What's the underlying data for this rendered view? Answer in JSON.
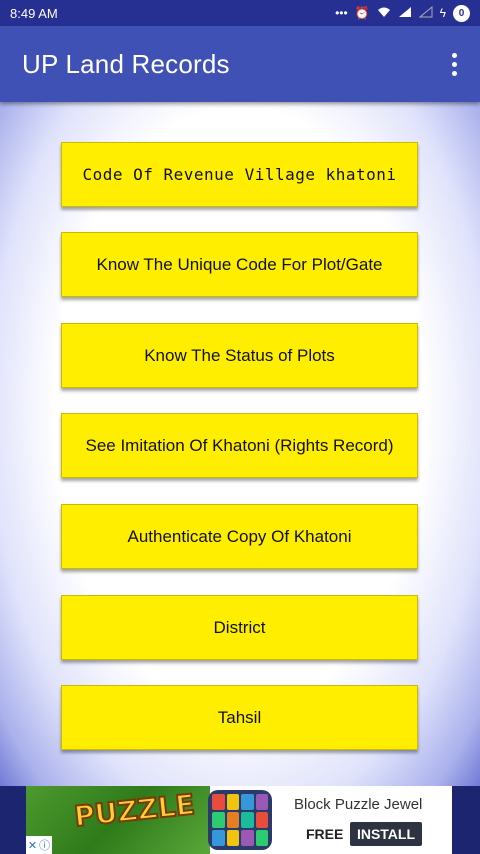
{
  "status_bar": {
    "time": "8:49 AM",
    "icons": [
      "dots-icon",
      "alarm-icon",
      "wifi-icon",
      "signal-icon",
      "signal-off-icon",
      "charging-icon",
      "battery-icon"
    ],
    "battery_label": "0"
  },
  "app_bar": {
    "title": "UP Land Records",
    "menu_icon": "more-vert-icon"
  },
  "menu": {
    "items": [
      {
        "label": "Code Of Revenue Village khatoni"
      },
      {
        "label": "Know The Unique Code For Plot/Gate"
      },
      {
        "label": "Know The Status of Plots"
      },
      {
        "label": "See Imitation Of Khatoni (Rights Record)"
      },
      {
        "label": "Authenticate Copy Of Khatoni"
      },
      {
        "label": "District"
      },
      {
        "label": "Tahsil"
      }
    ]
  },
  "ad": {
    "thumb_text": "PUZZLE",
    "app_name": "Block Puzzle Jewel",
    "price": "FREE",
    "install_label": "INSTALL",
    "choices_icons": [
      "close-icon",
      "info-icon"
    ]
  },
  "colors": {
    "status_bar": "#263092",
    "app_bar": "#3f51b5",
    "button": "#ffee00"
  }
}
